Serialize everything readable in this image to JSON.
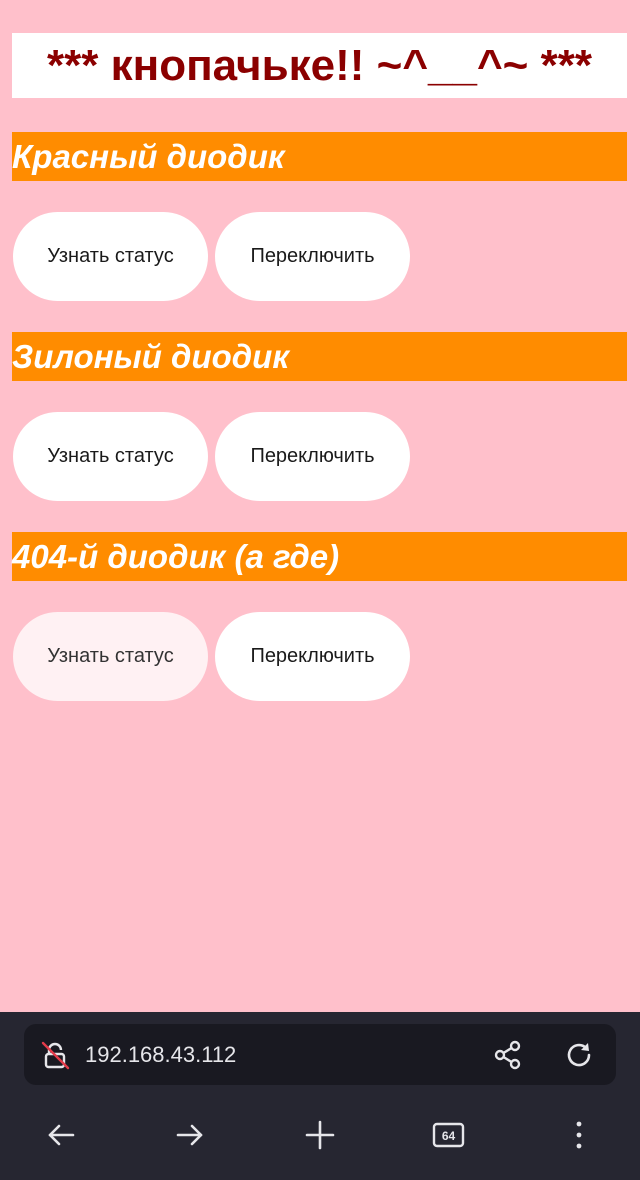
{
  "page": {
    "title": "*** кнопачьке!! ~^__^~ ***",
    "sections": [
      {
        "heading": "Красный диодик",
        "status_label": "Узнать статус",
        "toggle_label": "Переключить"
      },
      {
        "heading": "Зилоный диодик",
        "status_label": "Узнать статус",
        "toggle_label": "Переключить"
      },
      {
        "heading": "404-й диодик (а где)",
        "status_label": "Узнать статус",
        "toggle_label": "Переключить"
      }
    ]
  },
  "browser": {
    "url": "192.168.43.112",
    "tabs_count": "64",
    "icons": {
      "security": "insecure-lock-icon",
      "share": "share-icon",
      "reload": "reload-icon",
      "back": "back-arrow-icon",
      "forward": "forward-arrow-icon",
      "new_tab": "plus-icon",
      "tabs": "tabs-count-icon",
      "menu": "more-vertical-icon"
    }
  },
  "colors": {
    "background": "#ffc0cb",
    "title_text": "#8b0000",
    "section_bar": "#ff8c00",
    "button": "#ffffff",
    "toolbar": "#262631"
  }
}
